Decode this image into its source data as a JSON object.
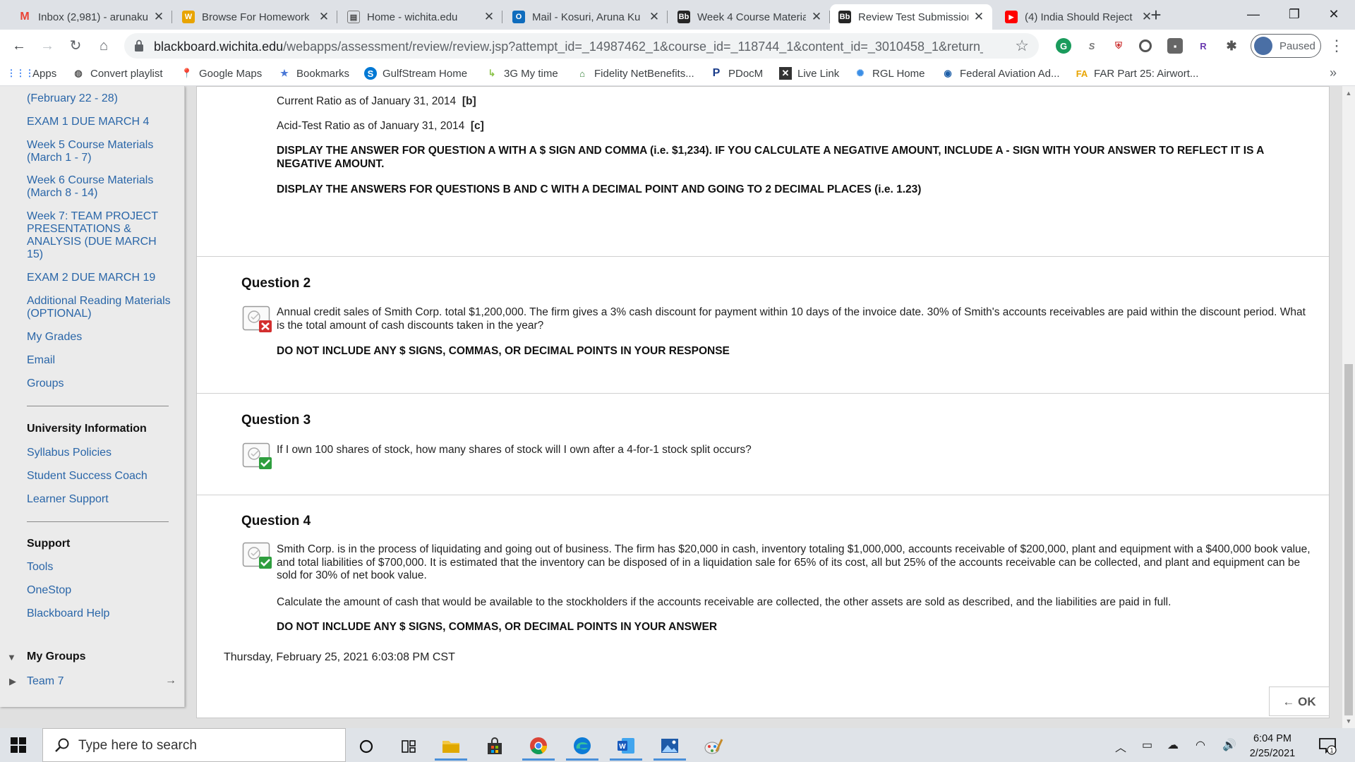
{
  "browser": {
    "tabs": [
      {
        "title": "Inbox (2,981) - arunaku",
        "icon": "gmail-icon",
        "active": false
      },
      {
        "title": "Browse For Homework",
        "icon": "homework-icon",
        "active": false
      },
      {
        "title": "Home - wichita.edu",
        "icon": "wichita-icon",
        "active": false
      },
      {
        "title": "Mail - Kosuri, Aruna Ku",
        "icon": "outlook-icon",
        "active": false
      },
      {
        "title": "Week 4 Course Materia",
        "icon": "blackboard-icon",
        "active": false
      },
      {
        "title": "Review Test Submission",
        "icon": "blackboard-icon",
        "active": true
      },
      {
        "title": "(4) India Should Reject",
        "icon": "youtube-icon",
        "active": false
      }
    ],
    "url_domain": "blackboard.wichita.edu",
    "url_path": "/webapps/assessment/review/review.jsp?attempt_id=_14987462_1&course_id=_118744_1&content_id=_3010458_1&return_content...",
    "profile_status": "Paused",
    "bookmarks": [
      {
        "label": "Apps",
        "icon": "apps-grid-icon"
      },
      {
        "label": "Convert playlist",
        "icon": "globe-icon"
      },
      {
        "label": "Google Maps",
        "icon": "map-pin-icon"
      },
      {
        "label": "Bookmarks",
        "icon": "star-icon"
      },
      {
        "label": "GulfStream Home",
        "icon": "sharepoint-icon"
      },
      {
        "label": "3G My time",
        "icon": "arrow-icon"
      },
      {
        "label": "Fidelity NetBenefits...",
        "icon": "fidelity-icon"
      },
      {
        "label": "PDocM",
        "icon": "p-icon"
      },
      {
        "label": "Live Link",
        "icon": "livelink-icon"
      },
      {
        "label": "RGL Home",
        "icon": "rgl-icon"
      },
      {
        "label": "Federal Aviation Ad...",
        "icon": "faa-icon"
      },
      {
        "label": "FAR Part 25: Airwort...",
        "icon": "far-icon"
      }
    ],
    "bookmarks_more": "»"
  },
  "sidebar": {
    "items": [
      {
        "label": "(February 22 - 28)"
      },
      {
        "label": "EXAM 1 DUE MARCH 4"
      },
      {
        "label": "Week 5 Course Materials (March 1 - 7)"
      },
      {
        "label": "Week 6 Course Materials (March 8 - 14)"
      },
      {
        "label": "Week 7: TEAM PROJECT PRESENTATIONS & ANALYSIS (DUE MARCH 15)"
      },
      {
        "label": "EXAM 2 DUE MARCH 19"
      },
      {
        "label": "Additional Reading Materials (OPTIONAL)"
      },
      {
        "label": "My Grades"
      },
      {
        "label": "Email"
      },
      {
        "label": "Groups"
      }
    ],
    "university_heading": "University Information",
    "university_items": [
      {
        "label": "Syllabus Policies"
      },
      {
        "label": "Student Success Coach"
      },
      {
        "label": "Learner Support"
      }
    ],
    "support_heading": "Support",
    "support_items": [
      {
        "label": "Tools"
      },
      {
        "label": "OneStop"
      },
      {
        "label": "Blackboard Help"
      }
    ],
    "my_groups_heading": "My Groups",
    "team_label": "Team 7",
    "team_arrow": "→"
  },
  "content": {
    "q1_line_b": "Current Ratio as of January 31, 2014",
    "q1_tag_b": "[b]",
    "q1_line_c": "Acid-Test Ratio as of January 31, 2014",
    "q1_tag_c": "[c]",
    "q1_instr_a": "DISPLAY THE ANSWER FOR QUESTION A WITH A $ SIGN AND COMMA (i.e. $1,234).  IF YOU CALCULATE A NEGATIVE AMOUNT, INCLUDE A - SIGN WITH YOUR ANSWER TO REFLECT IT IS A NEGATIVE AMOUNT.",
    "q1_instr_bc": "DISPLAY THE ANSWERS FOR QUESTIONS B AND C WITH A DECIMAL POINT AND GOING TO 2 DECIMAL PLACES (i.e. 1.23)",
    "questions": [
      {
        "title": "Question 2",
        "status": "incorrect",
        "text": "Annual credit sales of Smith Corp. total $1,200,000. The firm gives a 3% cash discount for payment within 10 days of the invoice date. 30% of Smith's accounts receivables are paid within the discount period. What is the total amount of cash discounts taken in the year?",
        "instruction": "DO NOT INCLUDE ANY $ SIGNS, COMMAS, OR DECIMAL POINTS IN YOUR RESPONSE"
      },
      {
        "title": "Question 3",
        "status": "correct",
        "text": "If I own 100 shares of stock, how many shares of stock will I own after a 4-for-1 stock split occurs?"
      },
      {
        "title": "Question 4",
        "status": "correct",
        "text": "Smith Corp. is in the process of liquidating and going out of business. The firm has $20,000 in cash, inventory totaling $1,000,000, accounts receivable of $200,000, plant and equipment with a $400,000 book value, and total liabilities of $700,000. It is estimated that the inventory can be disposed of in a liquidation sale for 65% of its cost, all but 25% of the accounts receivable can be collected, and plant and equipment can be sold for 30% of net book value.",
        "text2": "Calculate the amount of cash that would be available to the stockholders if the accounts receivable are collected, the other assets are sold as described, and the liabilities are paid in full.",
        "instruction": "DO NOT INCLUDE ANY $ SIGNS, COMMAS, OR DECIMAL POINTS IN YOUR ANSWER"
      }
    ],
    "timestamp": "Thursday, February 25, 2021 6:03:08 PM CST",
    "ok_label": "← OK"
  },
  "taskbar": {
    "search_placeholder": "Type here to search",
    "pinned": [
      "cortana-icon",
      "task-view-icon",
      "file-explorer-icon",
      "store-icon",
      "chrome-icon",
      "edge-icon",
      "word-icon",
      "photos-icon",
      "paint-icon"
    ],
    "time": "6:04 PM",
    "date": "2/25/2021",
    "notification_count": "1"
  },
  "colors": {
    "link": "#2a66a8",
    "incorrect": "#d32f2f",
    "correct": "#2e9e3e"
  }
}
